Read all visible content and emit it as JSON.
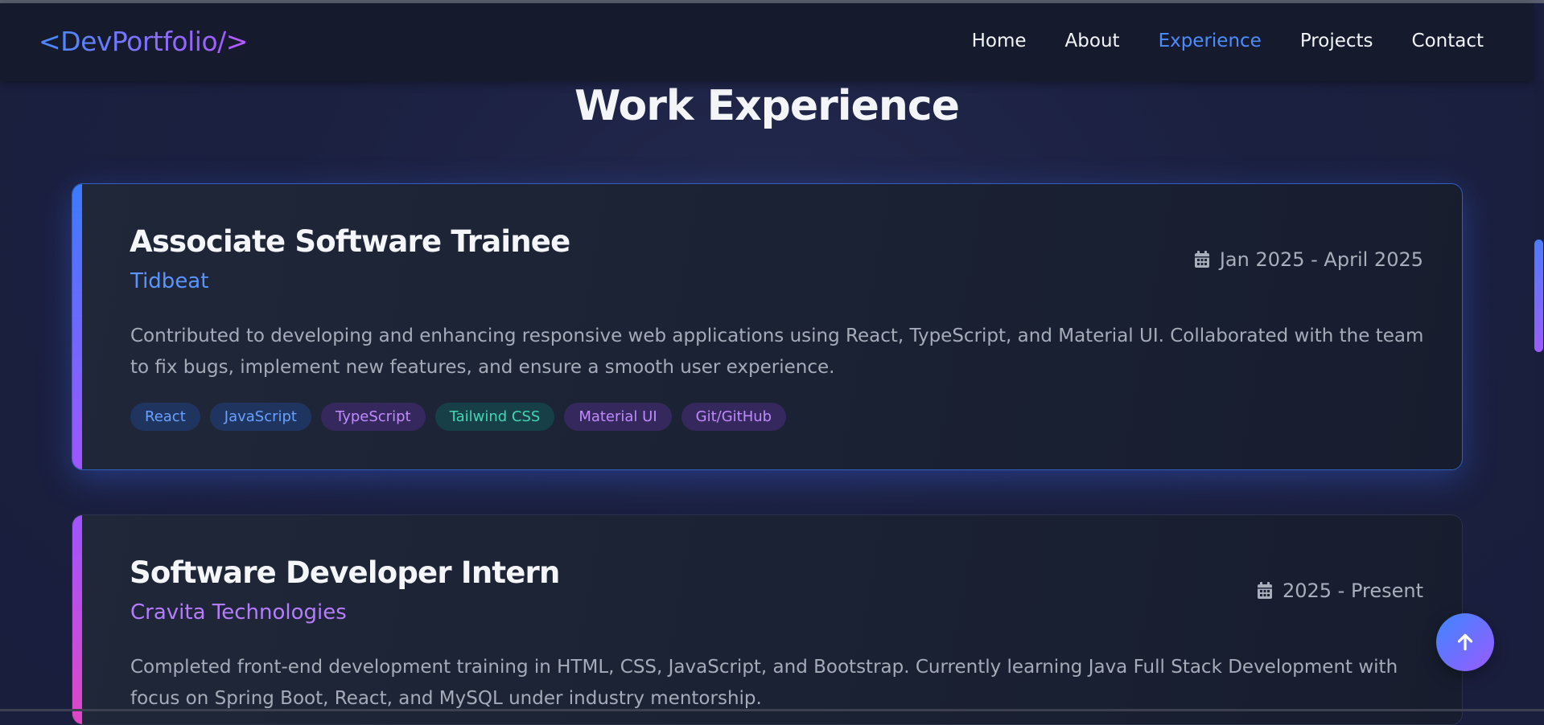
{
  "nav": {
    "logo": {
      "open": "<",
      "name": "DevPortfolio/",
      "close": ">"
    },
    "links": [
      {
        "label": "Home",
        "active": false
      },
      {
        "label": "About",
        "active": false
      },
      {
        "label": "Experience",
        "active": true
      },
      {
        "label": "Projects",
        "active": false
      },
      {
        "label": "Contact",
        "active": false
      }
    ]
  },
  "section": {
    "title": "Work Experience"
  },
  "experiences": [
    {
      "title": "Associate Software Trainee",
      "company": "Tidbeat",
      "date": "Jan 2025 - April 2025",
      "description": "Contributed to developing and enhancing responsive web applications using React, TypeScript, and Material UI. Collaborated with the team to fix bugs, implement new features, and ensure a smooth user experience.",
      "tags": [
        "React",
        "JavaScript",
        "TypeScript",
        "Tailwind CSS",
        "Material UI",
        "Git/GitHub"
      ]
    },
    {
      "title": "Software Developer Intern",
      "company": "Cravita Technologies",
      "date": "2025 - Present",
      "description": "Completed front-end development training in HTML, CSS, JavaScript, and Bootstrap. Currently learning Java Full Stack Development with focus on Spring Boot, React, and MySQL under industry mentorship."
    }
  ],
  "icons": {
    "calendar": "calendar-icon",
    "scroll_top": "arrow-up-icon"
  },
  "colors": {
    "accent_blue": "#4d8cff",
    "accent_purple": "#a055ff",
    "accent_pink": "#e046c6",
    "tag_green": "#42d6b3"
  }
}
